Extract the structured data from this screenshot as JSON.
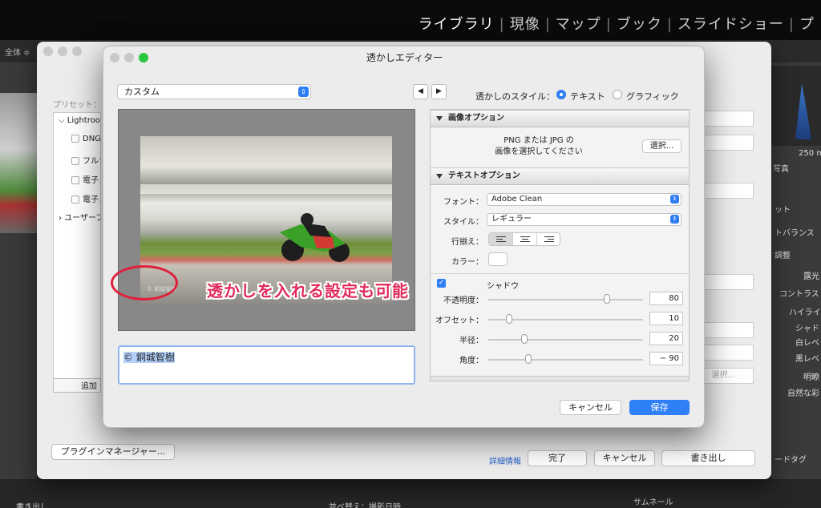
{
  "lightroom": {
    "modules": [
      "ライブラリ",
      "現像",
      "マップ",
      "ブック",
      "スライドショー",
      "プ"
    ],
    "filter_all": "全体 ≑",
    "right_panel": {
      "hist_value": "250 m",
      "original_photo": "写真",
      "items": [
        "ット",
        "トバランス",
        "調整",
        "露光",
        "コントラス",
        "ハイライ",
        "シャド",
        "白レベ",
        "黒レベ",
        "明瞭",
        "自然な彩"
      ],
      "keyword_tag": "ードタグ"
    },
    "bottom": {
      "export_button": "書き出し",
      "sort_label": "並べ替え：撮影日時",
      "thumbnail_label": "サムネール"
    }
  },
  "export_dialog": {
    "presets_label": "プリセット：",
    "tree": {
      "lightroom": "Lightroo",
      "items": [
        "DNG",
        "フルサ",
        "電子メ",
        "電子メ"
      ],
      "user": "ユーザープ"
    },
    "add_button": "追加",
    "plugin_manager_button": "プラグインマネージャー...",
    "details_link": "詳細情報",
    "done_button": "完了",
    "cancel_button": "キャンセル",
    "export_button": "書き出し",
    "right_select_label": "選択..."
  },
  "watermark_editor": {
    "title": "透かしエディター",
    "preset": "カスタム",
    "watermark_style_label": "透かしのスタイル：",
    "style_options": {
      "text": "テキスト",
      "graphic": "グラフィック"
    },
    "preview_watermark": "© 銅城智樹",
    "annotation": "透かしを入れる設定も可能",
    "text_value": "© 銅城智樹",
    "image_options": {
      "header": "画像オプション",
      "line1": "PNG または JPG の",
      "line2": "画像を選択してください",
      "choose_button": "選択..."
    },
    "text_options": {
      "header": "テキストオプション",
      "font_label": "フォント：",
      "font_value": "Adobe Clean",
      "style_label": "スタイル：",
      "style_value": "レギュラー",
      "align_label": "行揃え：",
      "color_label": "カラー：",
      "shadow_label": "シャドウ",
      "shadow_checked": true,
      "sliders": [
        {
          "label": "不透明度：",
          "value": "80",
          "pos": 0.78
        },
        {
          "label": "オフセット：",
          "value": "10",
          "pos": 0.12
        },
        {
          "label": "半径：",
          "value": "20",
          "pos": 0.22
        },
        {
          "label": "角度：",
          "value": "− 90",
          "pos": 0.25
        }
      ]
    },
    "cancel_button": "キャンセル",
    "save_button": "保存"
  }
}
